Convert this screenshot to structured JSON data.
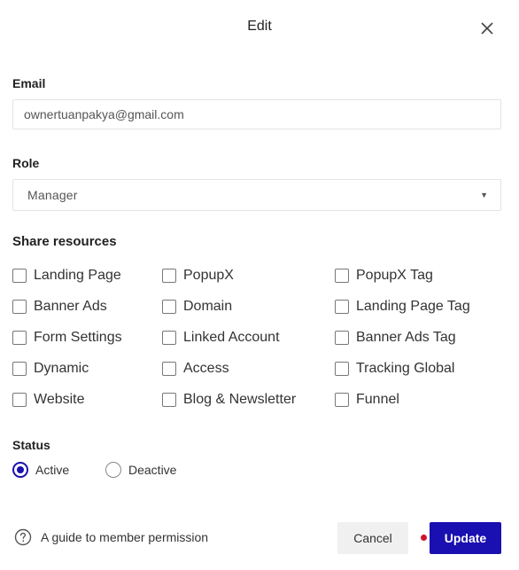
{
  "dialog": {
    "title": "Edit"
  },
  "email": {
    "label": "Email",
    "value": "ownertuanpakya@gmail.com"
  },
  "role": {
    "label": "Role",
    "value": "Manager"
  },
  "share": {
    "title": "Share resources",
    "col1": [
      "Landing Page",
      "Banner Ads",
      "Form Settings",
      "Dynamic",
      "Website"
    ],
    "col2": [
      "PopupX",
      "Domain",
      "Linked Account",
      "Access",
      "Blog & Newsletter"
    ],
    "col3": [
      "PopupX Tag",
      "Landing Page Tag",
      "Banner Ads Tag",
      "Tracking Global",
      "Funnel"
    ]
  },
  "status": {
    "label": "Status",
    "options": [
      "Active",
      "Deactive"
    ],
    "selected": "Active"
  },
  "footer": {
    "guide_text": "A guide to member permission",
    "cancel_label": "Cancel",
    "update_label": "Update"
  },
  "colors": {
    "primary": "#1a0fb0",
    "indicator": "#d0122c"
  }
}
